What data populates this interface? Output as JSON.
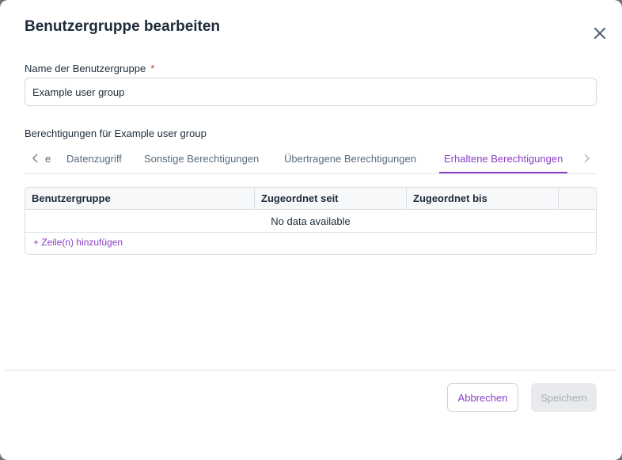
{
  "dialog": {
    "title": "Benutzergruppe bearbeiten",
    "close_icon": "close-icon"
  },
  "name_field": {
    "label": "Name der Benutzergruppe",
    "required_marker": "*",
    "value": "Example user group"
  },
  "permissions": {
    "label": "Berechtigungen für Example user group",
    "tabs": [
      {
        "label": "e",
        "truncated": true
      },
      {
        "label": "Datenzugriff"
      },
      {
        "label": "Sonstige Berechtigungen"
      },
      {
        "label": "Übertragene Berechtigungen"
      },
      {
        "label": "Erhaltene Berechtigungen",
        "active": true
      }
    ],
    "prev_icon": "chevron-left-icon",
    "next_icon": "chevron-right-icon"
  },
  "table": {
    "columns": [
      "Benutzergruppe",
      "Zugeordnet seit",
      "Zugeordnet bis"
    ],
    "rows": [],
    "empty_text": "No data available",
    "add_row_label": "+ Zeile(n) hinzufügen"
  },
  "footer": {
    "cancel_label": "Abbrechen",
    "save_label": "Speichern"
  },
  "colors": {
    "accent": "#8a3fc7",
    "required": "#d0302f",
    "text": "#1d2b3a"
  }
}
